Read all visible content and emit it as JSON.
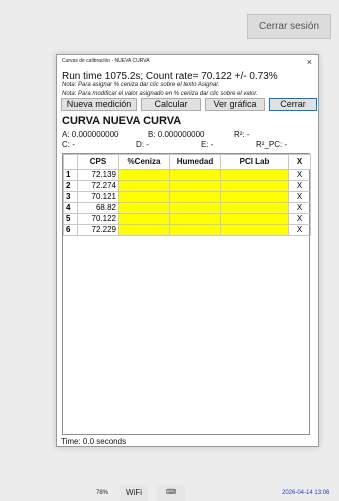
{
  "top": {
    "logout_label": "Cerrar sesión"
  },
  "dialog": {
    "title": "Curvas de calibración - NUEVA CURVA",
    "close_glyph": "×",
    "run_line": "Run time 1075.2s; Count rate= 70.122 +/- 0.73%",
    "note1": "Nota: Para asignar % ceniza dar clic sobre el texto Asignar.",
    "note2": "Nota: Para modificar el valor asignado en % ceniza dar clic sobre el valor.",
    "buttons": {
      "new_measurement": "Nueva medición",
      "calculate": "Calcular",
      "view_chart": "Ver gráfica",
      "close": "Cerrar"
    },
    "curve_title": "CURVA NUEVA CURVA",
    "stats": {
      "a": "A: 0.000000000",
      "b": "B: 0.000000000",
      "r2": "R²: -",
      "c": "C: -",
      "d": "D: -",
      "e": "E: -",
      "r2_pc": "R²_PC: -"
    },
    "table": {
      "headers": [
        "",
        "CPS",
        "%Ceniza",
        "Humedad",
        "PCI Lab",
        "X"
      ],
      "rows": [
        {
          "n": "1",
          "cps": "72.139",
          "x": "X"
        },
        {
          "n": "2",
          "cps": "72.274",
          "x": "X"
        },
        {
          "n": "3",
          "cps": "70.121",
          "x": "X"
        },
        {
          "n": "4",
          "cps": "68.82",
          "x": "X"
        },
        {
          "n": "5",
          "cps": "70.122",
          "x": "X"
        },
        {
          "n": "6",
          "cps": "72.229",
          "x": "X"
        }
      ]
    },
    "time_line": "Time: 0.0 seconds"
  },
  "taskbar": {
    "battery": "78%",
    "wifi": "WiFi",
    "keyboard_icon": "keyboard-icon",
    "keyboard_glyph": "⌨",
    "clock": "2026-04-14 13:06"
  },
  "colors": {
    "yellow_cell": "#ffff00",
    "clock_text": "#1f3fbf"
  }
}
